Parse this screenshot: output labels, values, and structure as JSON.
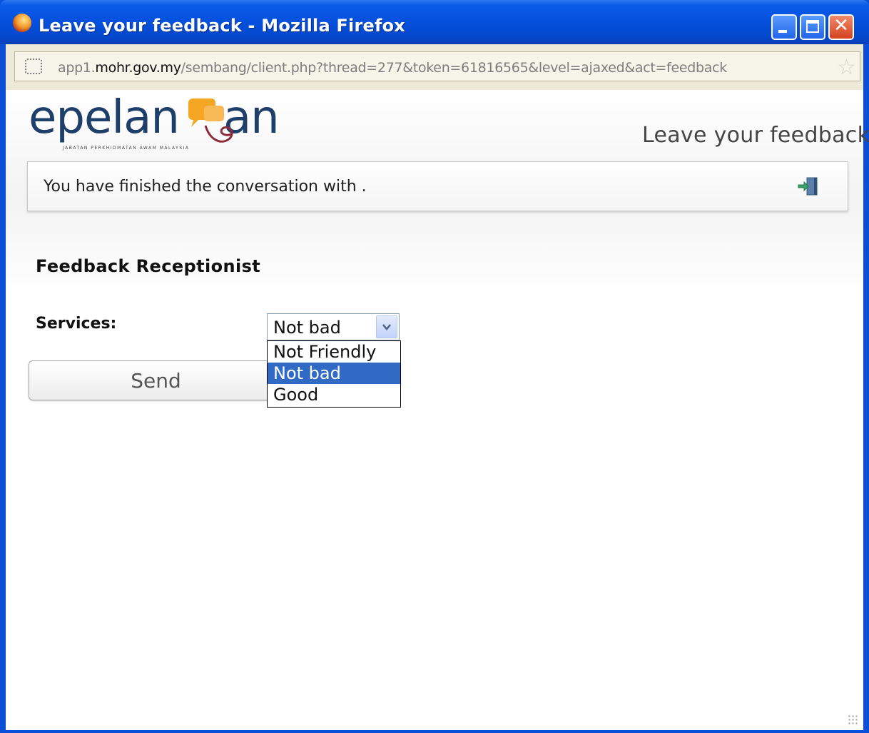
{
  "window": {
    "title": "Leave your feedback - Mozilla Firefox"
  },
  "address_bar": {
    "url_prefix": "app1.",
    "url_domain": "mohr.gov.my",
    "url_path": "/sembang/client.php?thread=277&token=61816565&level=ajaxed&act=feedback"
  },
  "header": {
    "logo_text": "epelan  an",
    "logo_tagline": "JABATAN PERKHIDMATAN AWAM MALAYSIA",
    "page_heading": "Leave your feedback"
  },
  "notice": {
    "text": "You have finished the conversation with ."
  },
  "form": {
    "section_title": "Feedback Receptionist",
    "services_label": "Services:",
    "services_selected": "Not bad",
    "services_options": [
      "Not Friendly",
      "Not bad",
      "Good"
    ],
    "send_label": "Send"
  },
  "colors": {
    "titlebar": "#0550dc",
    "selected_option": "#316ac5",
    "logo_blue": "#1f3f6b",
    "logo_orange": "#f5a623"
  }
}
